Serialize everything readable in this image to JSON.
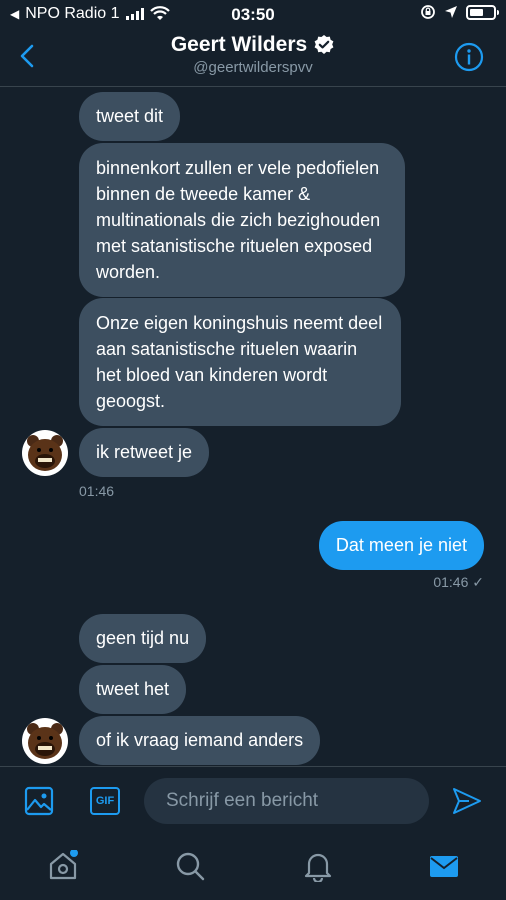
{
  "status_bar": {
    "back_app": "NPO Radio 1",
    "time": "03:50"
  },
  "header": {
    "title": "Geert Wilders",
    "handle": "@geertwilderspvv",
    "verified_icon": "verified-badge-icon"
  },
  "messages": [
    {
      "direction": "in",
      "text": "tweet dit"
    },
    {
      "direction": "in",
      "text": "binnenkort zullen er vele pedofielen binnen de tweede kamer & multinationals die zich bezighouden met satanistische rituelen exposed worden."
    },
    {
      "direction": "in",
      "text": "Onze eigen koningshuis neemt deel aan satanistische rituelen waarin het bloed van kinderen wordt geoogst."
    },
    {
      "direction": "in",
      "text": "ik retweet je",
      "time": "01:46"
    },
    {
      "direction": "out",
      "text": "Dat meen je niet",
      "time": "01:46",
      "status": "✓"
    },
    {
      "direction": "in",
      "text": "geen tijd nu"
    },
    {
      "direction": "in",
      "text": "tweet het"
    },
    {
      "direction": "in",
      "text": "of ik vraag iemand anders"
    }
  ],
  "compose": {
    "placeholder": "Schrijf een bericht",
    "gif_label": "GIF"
  },
  "colors": {
    "background": "#15202b",
    "incoming_bubble": "#3d4f60",
    "outgoing_bubble": "#1d9bf0",
    "accent": "#1d9bf0",
    "muted_text": "#8899a6"
  }
}
